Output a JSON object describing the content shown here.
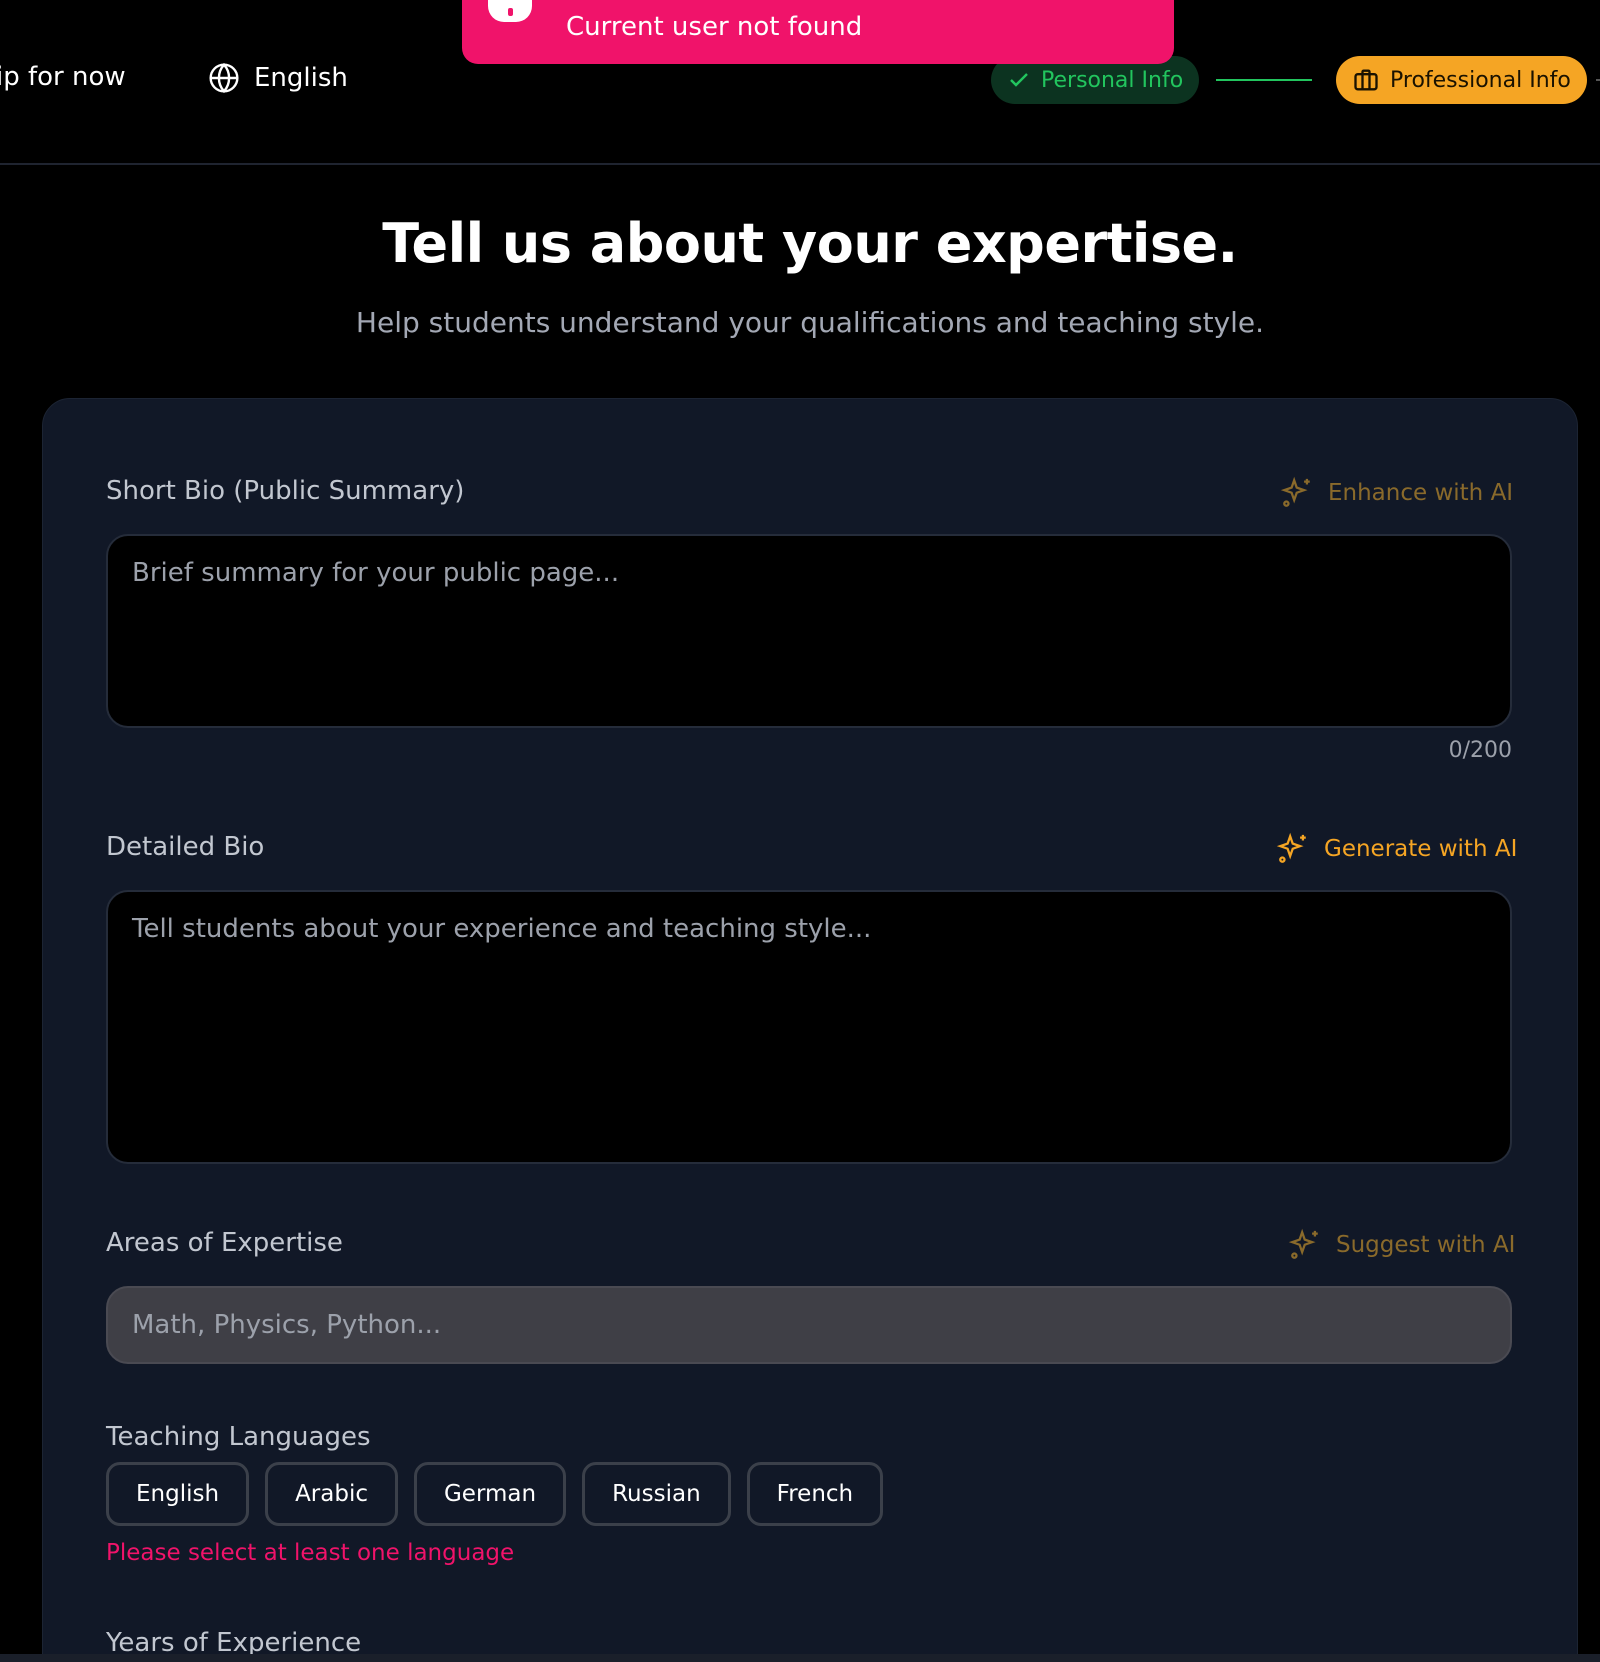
{
  "header": {
    "skip_label": "ip for now",
    "language_label": "English",
    "steps": {
      "personal_label": "Personal Info",
      "professional_label": "Professional Info"
    }
  },
  "toast": {
    "message": "Current user not found",
    "color": "#f0136a"
  },
  "page": {
    "title": "Tell us about your expertise.",
    "subtitle": "Help students understand your qualifications and teaching style."
  },
  "form": {
    "short_bio": {
      "label": "Short Bio (Public Summary)",
      "ai_label": "Enhance with AI",
      "placeholder": "Brief summary for your public page...",
      "counter": "0/200"
    },
    "detailed_bio": {
      "label": "Detailed Bio",
      "ai_label": "Generate with AI",
      "placeholder": "Tell students about your experience and teaching style..."
    },
    "expertise": {
      "label": "Areas of Expertise",
      "ai_label": "Suggest with AI",
      "placeholder": "Math, Physics, Python..."
    },
    "languages": {
      "label": "Teaching Languages",
      "options": [
        "English",
        "Arabic",
        "German",
        "Russian",
        "French"
      ],
      "error": "Please select at least one language"
    },
    "experience": {
      "label": "Years of Experience"
    }
  },
  "colors": {
    "accent": "#f5a524",
    "success": "#22c55e",
    "error": "#f0136a",
    "card_bg": "#111827"
  },
  "icons": [
    "globe-icon",
    "check-icon",
    "briefcase-icon",
    "sparkles-icon",
    "alert-icon"
  ]
}
